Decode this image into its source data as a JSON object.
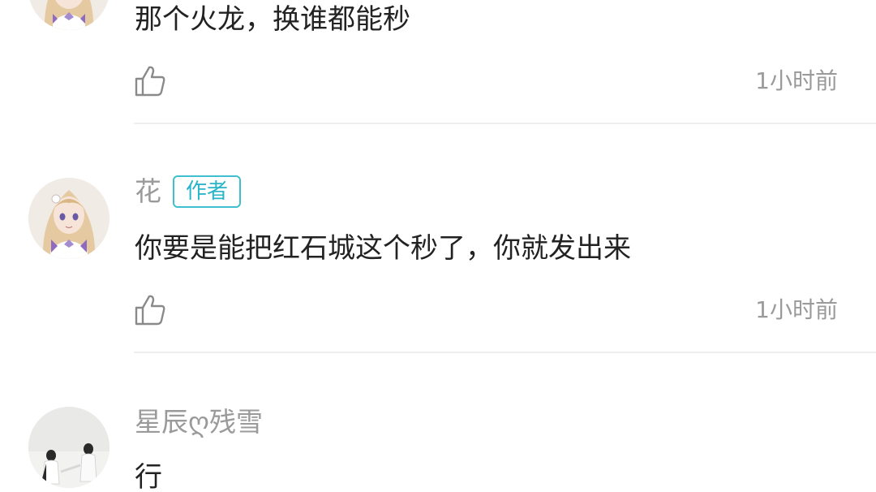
{
  "comments": [
    {
      "username": "",
      "is_author": false,
      "text": "那个火龙，换谁都能秒",
      "time": "1小时前",
      "avatar_icon": "anime-girl-avatar"
    },
    {
      "username": "花",
      "is_author": true,
      "author_badge": "作者",
      "text": "你要是能把红石城这个秒了，你就发出来",
      "time": "1小时前",
      "avatar_icon": "anime-girl-avatar"
    },
    {
      "username": "星辰ღ残雪",
      "is_author": false,
      "text": "行",
      "time": "",
      "avatar_icon": "photo-avatar"
    }
  ],
  "like_icon": "thumbs-up-icon",
  "colors": {
    "username": "#9a9a9a",
    "text": "#222222",
    "badge": "#29b5c9",
    "divider": "#eeeeee",
    "icon": "#8a8a8a"
  }
}
